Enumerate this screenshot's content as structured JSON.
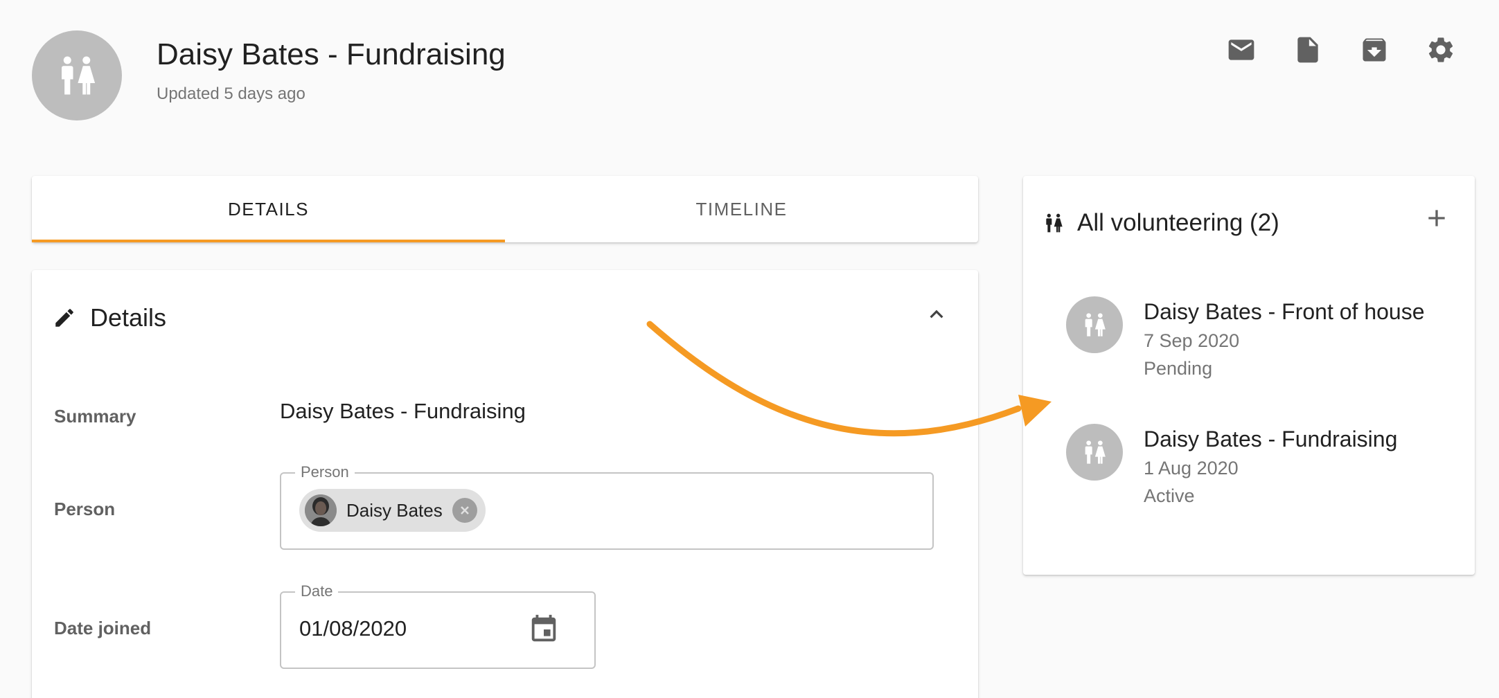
{
  "header": {
    "title": "Daisy Bates - Fundraising",
    "subtitle": "Updated 5 days ago",
    "avatar_icon": "people-icon",
    "actions": [
      {
        "name": "email-button",
        "icon": "email-icon"
      },
      {
        "name": "document-button",
        "icon": "document-icon"
      },
      {
        "name": "archive-button",
        "icon": "archive-icon"
      },
      {
        "name": "settings-button",
        "icon": "gear-icon"
      }
    ]
  },
  "tabs": [
    {
      "label": "DETAILS",
      "active": true
    },
    {
      "label": "TIMELINE",
      "active": false
    }
  ],
  "details": {
    "title": "Details",
    "fields": {
      "summary": {
        "label": "Summary",
        "value": "Daisy Bates - Fundraising"
      },
      "person": {
        "label": "Person",
        "field_label": "Person",
        "chip_label": "Daisy Bates"
      },
      "date_joined": {
        "label": "Date joined",
        "field_label": "Date",
        "value": "01/08/2020"
      }
    }
  },
  "sidebar": {
    "title": "All volunteering (2)",
    "items": [
      {
        "name": "Daisy Bates - Front of house",
        "date": "7 Sep 2020",
        "status": "Pending"
      },
      {
        "name": "Daisy Bates - Fundraising",
        "date": "1 Aug 2020",
        "status": "Active"
      }
    ]
  },
  "colors": {
    "accent": "#f59a23",
    "avatar_bg": "#bdbdbd",
    "page_bg": "#fafafa"
  }
}
